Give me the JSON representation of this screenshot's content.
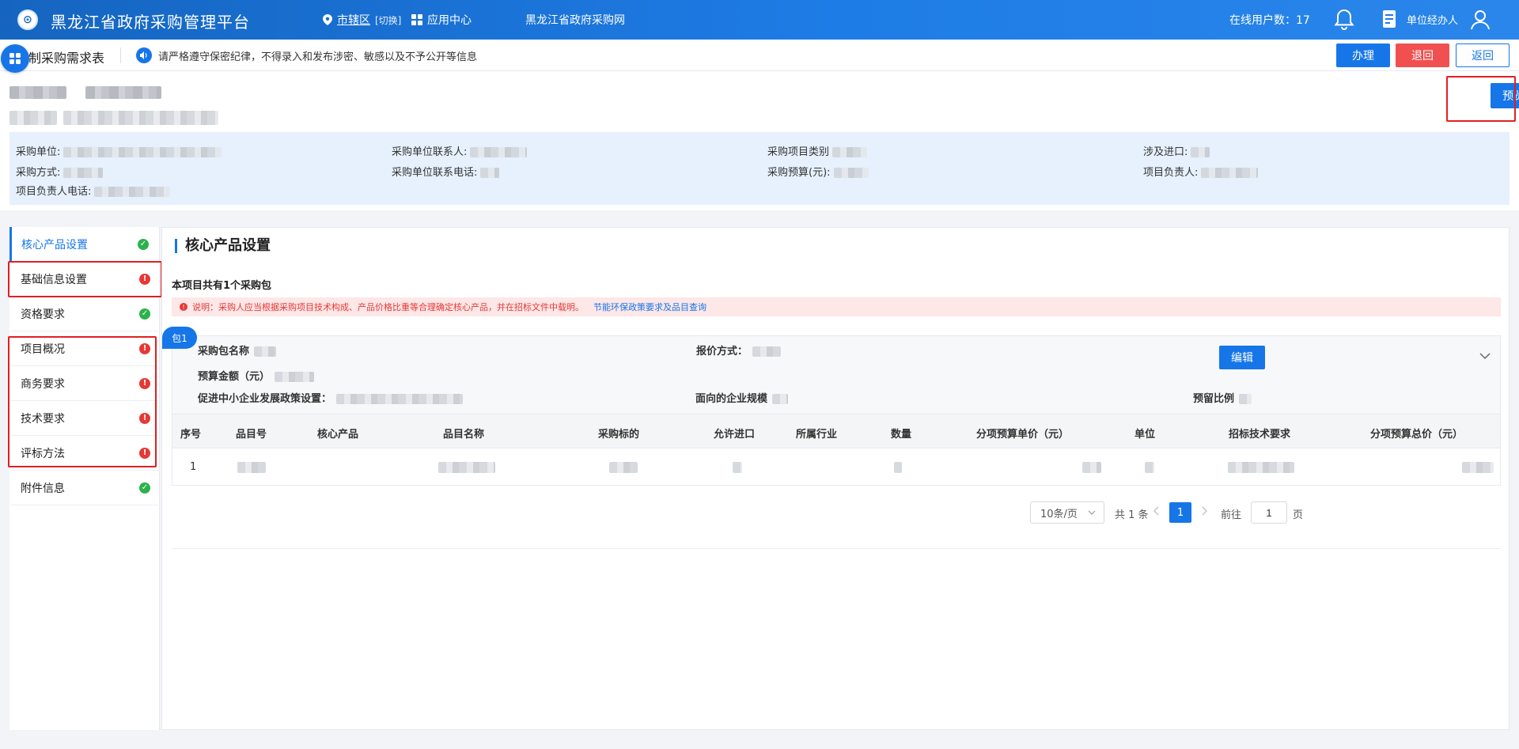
{
  "header": {
    "logo_glyph": "⊙",
    "title": "黑龙江省政府采购管理平台",
    "region_label": "市辖区",
    "region_switch": "[切换]",
    "app_center": "应用中心",
    "portal": "黑龙江省政府采购网",
    "online_users": "在线用户数：17",
    "role": "单位经办人"
  },
  "subbar": {
    "page_title": "制采购需求表",
    "notice": "请严格遵守保密纪律，不得录入和发布涉密、敏感以及不予公开等信息",
    "handle_label": "办理",
    "reject_label": "退回",
    "back_label": "返回"
  },
  "project": {
    "preview_label": "预览",
    "fields": [
      {
        "label": "采购单位:"
      },
      {
        "label": "采购单位联系人:"
      },
      {
        "label": "采购项目类别"
      },
      {
        "label": "涉及进口:"
      },
      {
        "label": "采购方式:"
      },
      {
        "label": "采购单位联系电话:"
      },
      {
        "label": "采购预算(元):"
      },
      {
        "label": "项目负责人:"
      },
      {
        "label": "项目负责人电话:"
      }
    ]
  },
  "sidebar": {
    "items": [
      {
        "label": "核心产品设置",
        "status": "ok"
      },
      {
        "label": "基础信息设置",
        "status": "error"
      },
      {
        "label": "资格要求",
        "status": "ok"
      },
      {
        "label": "项目概况",
        "status": "error"
      },
      {
        "label": "商务要求",
        "status": "error"
      },
      {
        "label": "技术要求",
        "status": "error"
      },
      {
        "label": "评标方法",
        "status": "error"
      },
      {
        "label": "附件信息",
        "status": "ok"
      }
    ]
  },
  "main": {
    "section_title": "核心产品设置",
    "package_count": "本项目共有1个采购包",
    "warning": "说明：采购人应当根据采购项目技术构成、产品价格比重等合理确定核心产品，并在招标文件中载明。",
    "warning_link": "节能环保政策要求及品目查询",
    "package": {
      "tag": "包1",
      "name_label": "采购包名称",
      "quote_label": "报价方式：",
      "budget_label": "预算金额（元）",
      "sme_label": "促进中小企业发展政策设置：",
      "scale_label": "面向的企业规模",
      "reserve_label": "预留比例",
      "edit_label": "编辑"
    },
    "table": {
      "headers": [
        "序号",
        "品目号",
        "核心产品",
        "品目名称",
        "采购标的",
        "允许进口",
        "所属行业",
        "数量",
        "分项预算单价（元）",
        "单位",
        "招标技术要求",
        "分项预算总价（元）"
      ],
      "rows": [
        {
          "index": "1"
        }
      ]
    },
    "pager": {
      "page_size": "10条/页",
      "total": "共 1 条",
      "current_page": "1",
      "goto": "前往",
      "goto_value": "1",
      "unit": "页"
    }
  },
  "colors": {
    "primary": "#1676e8",
    "danger": "#f05050",
    "success": "#2bb24c",
    "info_bg": "#e6f1fd"
  }
}
